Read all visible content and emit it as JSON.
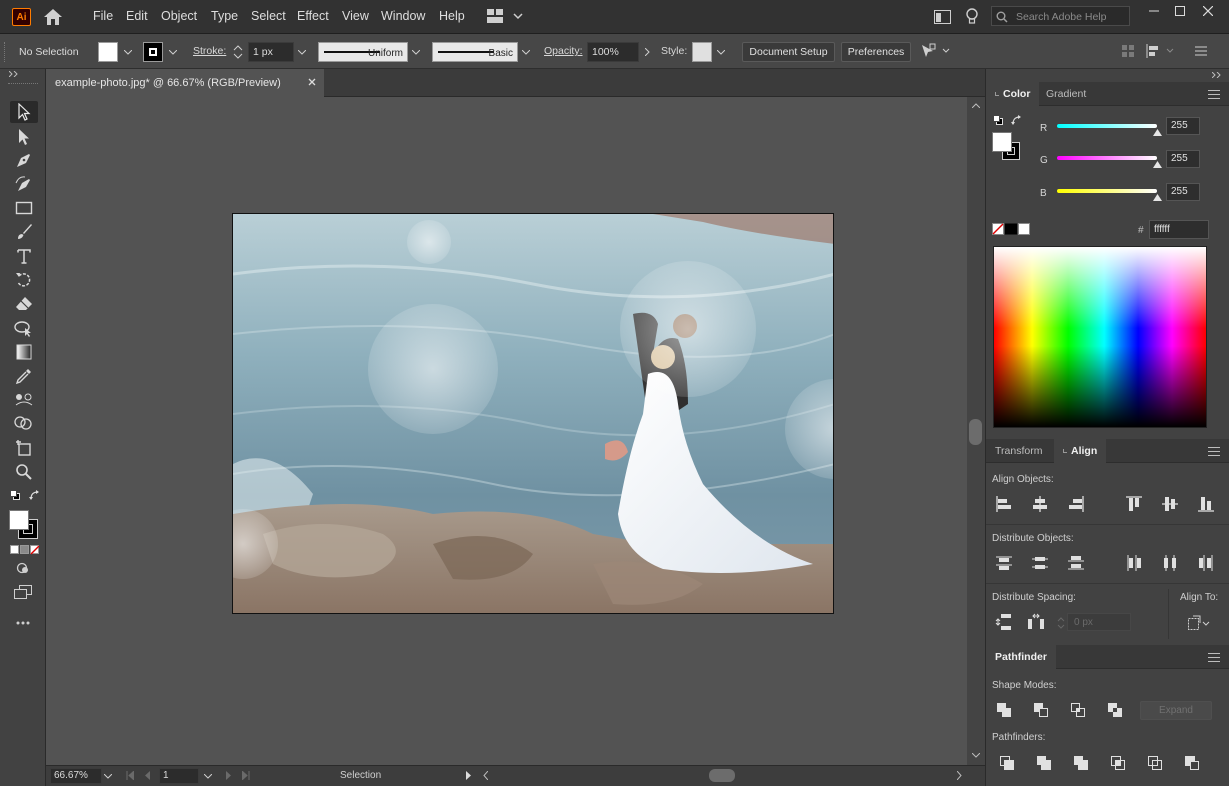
{
  "app": {
    "logo": "Ai",
    "brand_color": "#ff7c00",
    "logo_bg": "#330000"
  },
  "menu": [
    "File",
    "Edit",
    "Object",
    "Type",
    "Select",
    "Effect",
    "View",
    "Window",
    "Help"
  ],
  "search": {
    "placeholder": "Search Adobe Help"
  },
  "control_bar": {
    "selection_label": "No Selection",
    "stroke_label": "Stroke:",
    "stroke_width": "1 px",
    "stroke_profile": "Uniform",
    "brush": "Basic",
    "opacity_label": "Opacity:",
    "opacity_value": "100%",
    "style_label": "Style:",
    "document_setup": "Document Setup",
    "preferences": "Preferences"
  },
  "document": {
    "tab_title": "example-photo.jpg* @ 66.67% (RGB/Preview)",
    "zoom": "66.67%",
    "artboard": "1",
    "status_tool": "Selection"
  },
  "tools": [
    "selection-tool-icon",
    "direct-selection-tool-icon",
    "pen-tool-icon",
    "curvature-tool-icon",
    "rectangle-tool-icon",
    "paintbrush-tool-icon",
    "type-tool-icon",
    "rotate-tool-icon",
    "eraser-tool-icon",
    "width-tool-icon",
    "gradient-tool-icon",
    "eyedropper-tool-icon",
    "blend-tool-icon",
    "shape-builder-tool-icon",
    "artboard-tool-icon",
    "zoom-tool-icon"
  ],
  "color_panel": {
    "tabs": [
      "Color",
      "Gradient"
    ],
    "r_label": "R",
    "g_label": "G",
    "b_label": "B",
    "r": "255",
    "g": "255",
    "b": "255",
    "hex_label": "#",
    "hex": "ffffff",
    "r_level": 1.0,
    "g_level": 1.0,
    "b_level": 1.0
  },
  "align_panel": {
    "tabs": [
      "Transform",
      "Align"
    ],
    "align_objects": "Align Objects:",
    "distribute_objects": "Distribute Objects:",
    "distribute_spacing": "Distribute Spacing:",
    "align_to": "Align To:",
    "spacing_value": "0 px"
  },
  "pathfinder_panel": {
    "tab": "Pathfinder",
    "shape_modes": "Shape Modes:",
    "expand": "Expand",
    "pathfinders": "Pathfinders:"
  }
}
